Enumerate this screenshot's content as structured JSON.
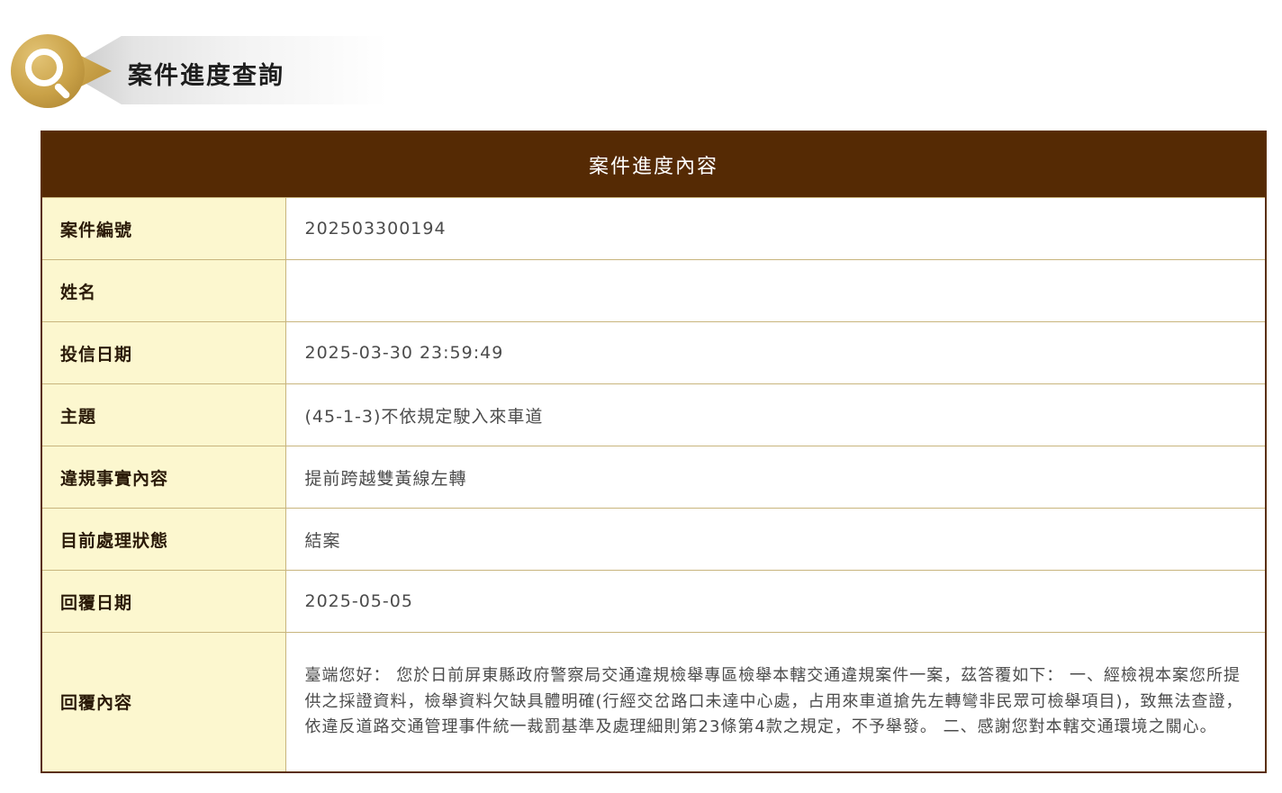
{
  "page": {
    "title": "案件進度查詢"
  },
  "panel": {
    "title": "案件進度內容",
    "rows": [
      {
        "label": "案件編號",
        "value": "202503300194"
      },
      {
        "label": "姓名",
        "value": ""
      },
      {
        "label": "投信日期",
        "value": "2025-03-30 23:59:49"
      },
      {
        "label": "主題",
        "value": "(45-1-3)不依規定駛入來車道"
      },
      {
        "label": "違規事實內容",
        "value": "提前跨越雙黃線左轉"
      },
      {
        "label": "目前處理狀態",
        "value": "結案"
      },
      {
        "label": "回覆日期",
        "value": "2025-05-05"
      },
      {
        "label": "回覆內容",
        "value": "臺端您好： 您於日前屏東縣政府警察局交通違規檢舉專區檢舉本轄交通違規案件一案，茲答覆如下： 一、經檢視本案您所提供之採證資料，檢舉資料欠缺具體明確(行經交岔路口未達中心處，占用來車道搶先左轉彎非民眾可檢舉項目)，致無法查證，依違反道路交通管理事件統一裁罰基準及處理細則第23條第4款之規定，不予舉發。 二、感謝您對本轄交通環境之關心。"
      }
    ]
  },
  "colors": {
    "header_bar": "#552a04",
    "label_bg": "#fcf7cf",
    "border": "#c8b57d",
    "logo_gold": "#c9a147"
  },
  "icons": {
    "logo": "search-magnifier-icon"
  }
}
